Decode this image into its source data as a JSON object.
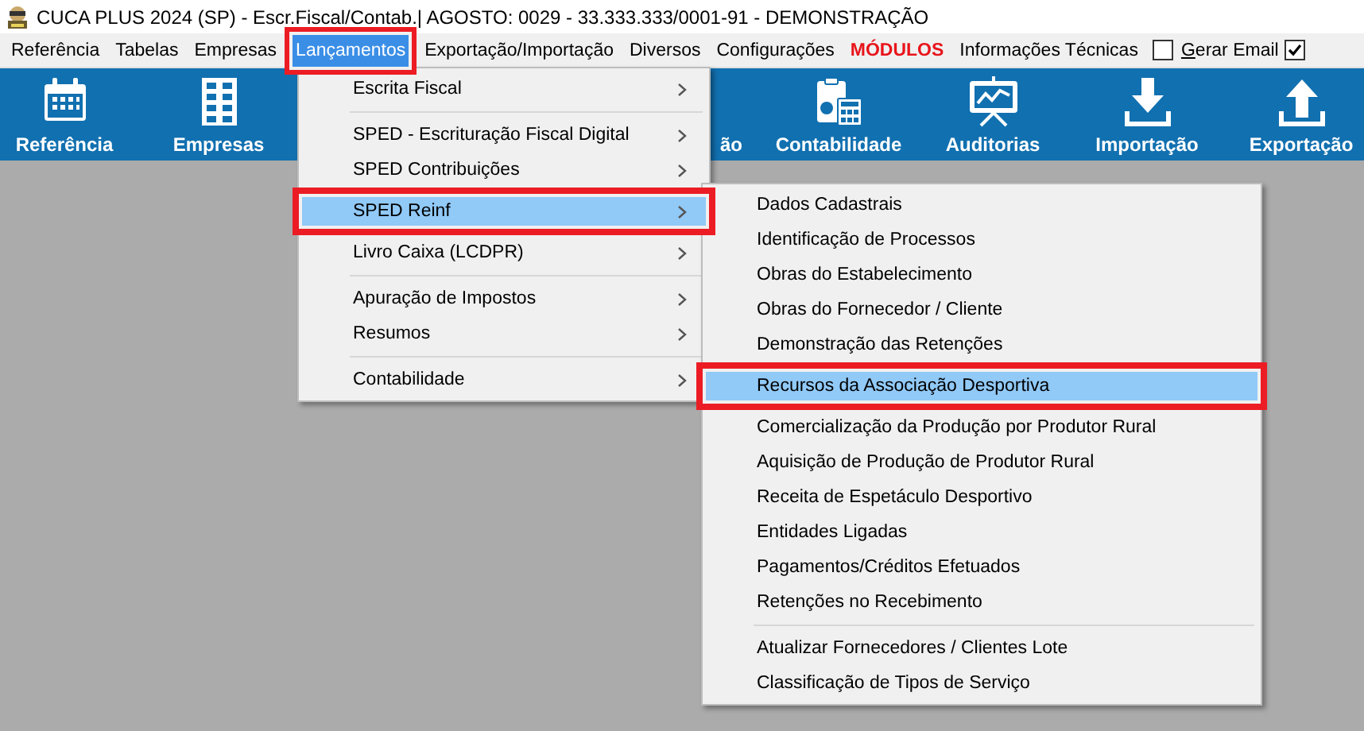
{
  "window": {
    "title": "CUCA PLUS 2024 (SP) - Escr.Fiscal/Contab.| AGOSTO: 0029 - 33.333.333/0001-91 - DEMONSTRAÇÃO"
  },
  "menu_bar": [
    {
      "kind": "menu",
      "label": "Referência",
      "selected": false,
      "highlighted": false
    },
    {
      "kind": "menu",
      "label": "Tabelas",
      "selected": false,
      "highlighted": false
    },
    {
      "kind": "menu",
      "label": "Empresas",
      "selected": false,
      "highlighted": false
    },
    {
      "kind": "menu",
      "label": "Lançamentos",
      "selected": true,
      "highlighted": true
    },
    {
      "kind": "menu",
      "label": "Exportação/Importação",
      "selected": false,
      "highlighted": false
    },
    {
      "kind": "menu",
      "label": "Diversos",
      "selected": false,
      "highlighted": false
    },
    {
      "kind": "menu",
      "label": "Configurações",
      "selected": false,
      "highlighted": false
    },
    {
      "kind": "alert",
      "label": "MÓDULOS",
      "selected": false,
      "highlighted": false
    },
    {
      "kind": "menu",
      "label": "Informações Técnicas",
      "selected": false,
      "highlighted": false
    },
    {
      "kind": "checkbox",
      "label": "Gerar Email",
      "checked": false
    },
    {
      "kind": "checkbox",
      "checked": true
    }
  ],
  "toolbar": [
    {
      "kind": "calendar",
      "label": "Referência"
    },
    {
      "kind": "building",
      "label": "Empresas"
    },
    {
      "kind": "covered",
      "label": "ão"
    },
    {
      "kind": "accounting",
      "label": "Contabilidade"
    },
    {
      "kind": "presentation",
      "label": "Auditorias"
    },
    {
      "kind": "download",
      "label": "Importação"
    },
    {
      "kind": "upload",
      "label": "Exportação"
    }
  ],
  "menu": [
    {
      "kind": "item",
      "label": "Escrita Fiscal",
      "selected": false,
      "highlighted": false
    },
    {
      "kind": "separator"
    },
    {
      "kind": "item",
      "label": "SPED - Escrituração Fiscal Digital",
      "selected": false,
      "highlighted": false
    },
    {
      "kind": "item",
      "label": "SPED Contribuições",
      "selected": false,
      "highlighted": false
    },
    {
      "kind": "item",
      "label": "SPED Reinf",
      "selected": true,
      "highlighted": true
    },
    {
      "kind": "item",
      "label": "Livro Caixa (LCDPR)",
      "selected": false,
      "highlighted": false
    },
    {
      "kind": "separator"
    },
    {
      "kind": "item",
      "label": "Apuração de Impostos",
      "selected": false,
      "highlighted": false
    },
    {
      "kind": "item",
      "label": "Resumos",
      "selected": false,
      "highlighted": false
    },
    {
      "kind": "separator"
    },
    {
      "kind": "item",
      "label": "Contabilidade",
      "selected": false,
      "highlighted": false
    }
  ],
  "submenu": [
    {
      "kind": "item",
      "label": "Dados Cadastrais",
      "selected": false,
      "highlighted": false
    },
    {
      "kind": "item",
      "label": "Identificação de Processos",
      "selected": false,
      "highlighted": false
    },
    {
      "kind": "item",
      "label": "Obras do Estabelecimento",
      "selected": false,
      "highlighted": false
    },
    {
      "kind": "item",
      "label": "Obras do Fornecedor / Cliente",
      "selected": false,
      "highlighted": false
    },
    {
      "kind": "item",
      "label": "Demonstração das Retenções",
      "selected": false,
      "highlighted": false
    },
    {
      "kind": "item",
      "label": "Recursos da Associação Desportiva",
      "selected": true,
      "highlighted": true
    },
    {
      "kind": "item",
      "label": "Comercialização da Produção por Produtor Rural",
      "selected": false,
      "highlighted": false
    },
    {
      "kind": "item",
      "label": "Aquisição de Produção de Produtor Rural",
      "selected": false,
      "highlighted": false
    },
    {
      "kind": "item",
      "label": "Receita de Espetáculo Desportivo",
      "selected": false,
      "highlighted": false
    },
    {
      "kind": "item",
      "label": "Entidades Ligadas",
      "selected": false,
      "highlighted": false
    },
    {
      "kind": "item",
      "label": "Pagamentos/Créditos Efetuados",
      "selected": false,
      "highlighted": false
    },
    {
      "kind": "item",
      "label": "Retenções no Recebimento",
      "selected": false,
      "highlighted": false
    },
    {
      "kind": "separator"
    },
    {
      "kind": "item",
      "label": "Atualizar Fornecedores / Clientes Lote",
      "selected": false,
      "highlighted": false
    },
    {
      "kind": "item",
      "label": "Classificação de Tipos de Serviço",
      "selected": false,
      "highlighted": false
    }
  ]
}
